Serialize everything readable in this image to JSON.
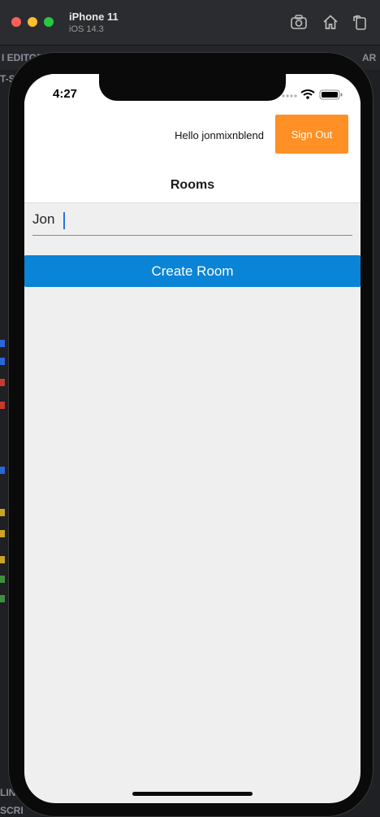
{
  "simulator": {
    "device_name": "iPhone 11",
    "os_version": "iOS 14.3",
    "toolbar_icons": [
      "screenshot-icon",
      "home-icon",
      "rotate-icon"
    ]
  },
  "background_editor": {
    "top_left_text": "I EDITOR",
    "top_right_text": "AR",
    "second_line_text": "T-S",
    "bottom_left_text": "LIN",
    "bottom_left_text2": "SCRI"
  },
  "status_bar": {
    "time": "4:27",
    "icons": [
      "signal-dots-icon",
      "wifi-icon",
      "battery-icon"
    ]
  },
  "header": {
    "greeting": "Hello jonmixnblend",
    "sign_out_label": "Sign Out",
    "title": "Rooms"
  },
  "room_form": {
    "room_name_value": "Jon",
    "create_label": "Create Room"
  },
  "colors": {
    "sign_out_bg": "#ff9026",
    "create_bg": "#0a84d6",
    "screen_bg": "#efefef"
  }
}
